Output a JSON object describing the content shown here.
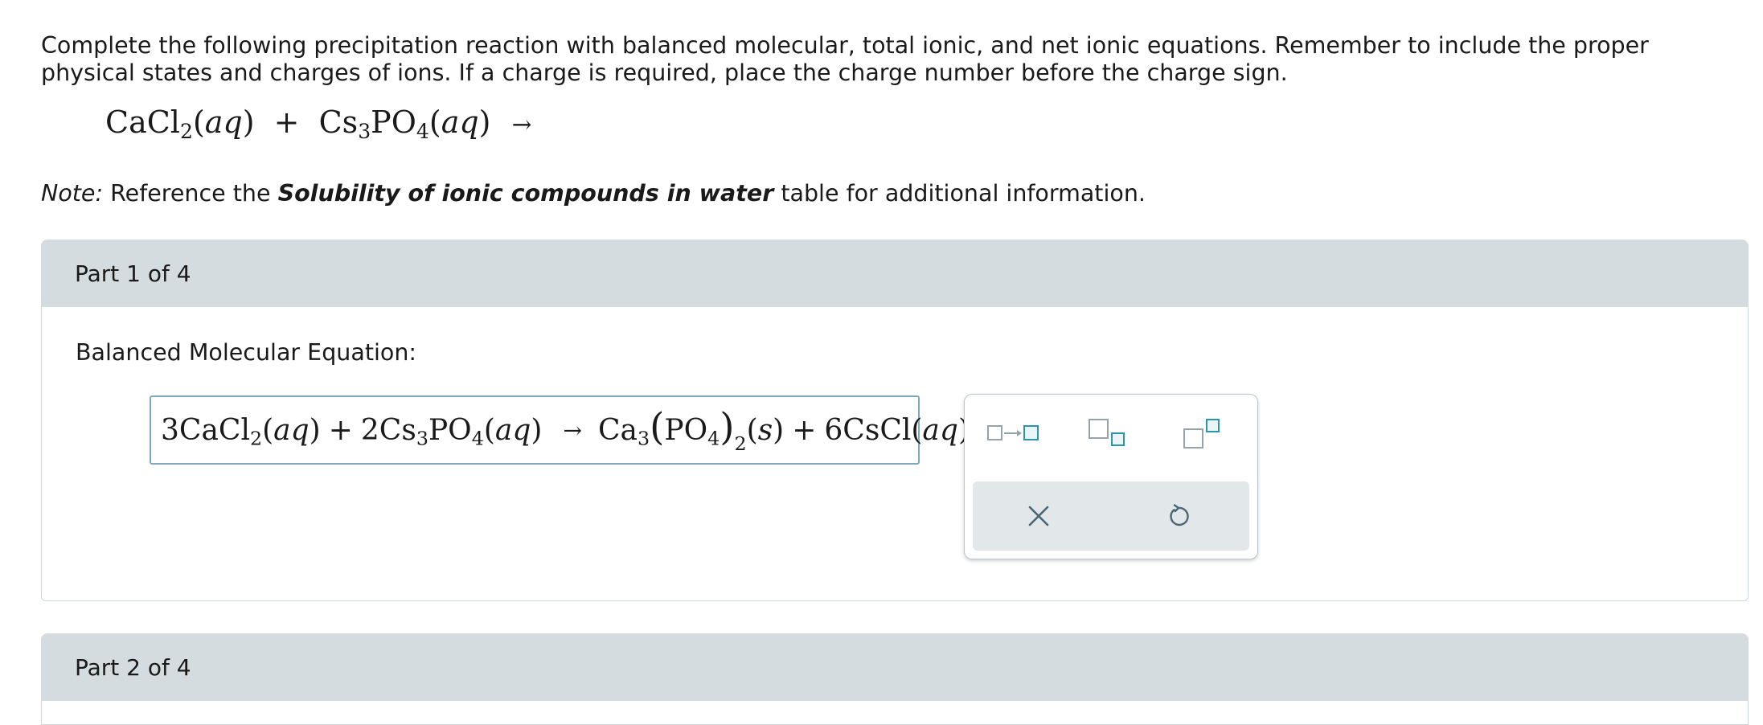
{
  "instructions": "Complete the following precipitation reaction with balanced molecular, total ionic, and net ionic equations. Remember to include the proper physical states and charges of ions. If a charge is required, place the charge number before the charge sign.",
  "reaction": {
    "r1_base": "CaCl",
    "r1_sub": "2",
    "r1_state": "aq",
    "plus": "+",
    "r2_base": "Cs",
    "r2_sub1": "3",
    "r2_mid": "PO",
    "r2_sub2": "4",
    "r2_state": "aq",
    "arrow": "→"
  },
  "note": {
    "prefix": "Note:",
    "text1": "Reference the",
    "link": "Solubility of ionic compounds in water",
    "text2": "table for additional information."
  },
  "part1": {
    "header": "Part 1 of 4",
    "label": "Balanced Molecular Equation:",
    "answer": {
      "c1": "3CaCl",
      "c1_sub": "2",
      "c1_state": "aq",
      "plus1": "+",
      "c2_a": "2Cs",
      "c2_sub1": "3",
      "c2_b": "PO",
      "c2_sub2": "4",
      "c2_state": "aq",
      "arrow": "→",
      "p1_a": "Ca",
      "p1_sub1": "3",
      "p1_b": "PO",
      "p1_sub2": "4",
      "p1_sub3": "2",
      "p1_state": "s",
      "plus2": "+",
      "p2": "6CsCl",
      "p2_state": "aq"
    }
  },
  "toolbar": {
    "tools": [
      "reaction-arrow-icon",
      "subscript-icon",
      "superscript-icon"
    ],
    "actions": [
      "clear-icon",
      "undo-icon"
    ],
    "accent": "#2c94b2"
  },
  "part2": {
    "header": "Part 2 of 4"
  }
}
